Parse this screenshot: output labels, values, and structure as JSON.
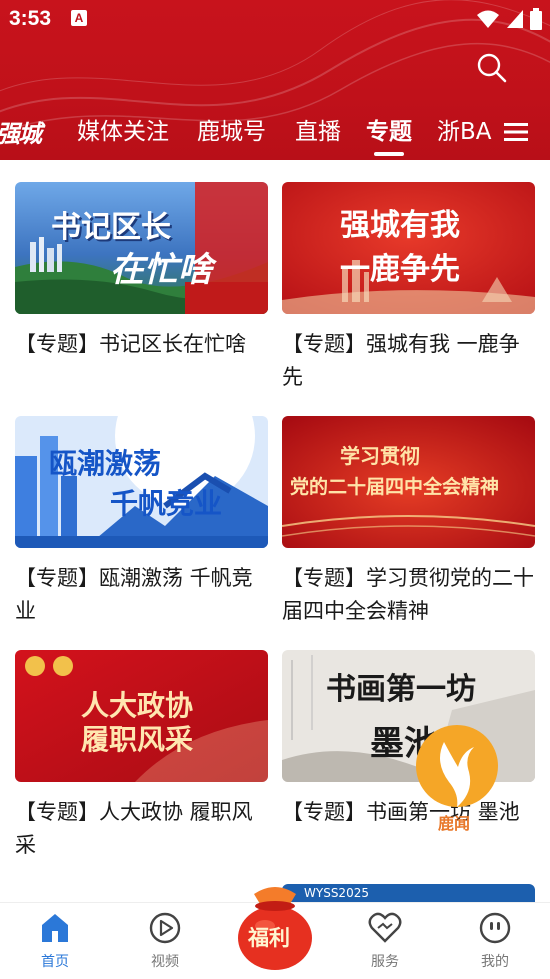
{
  "status_bar": {
    "time": "3:53",
    "notif_icon": "A"
  },
  "header": {
    "logo_text": "强城",
    "tabs": [
      {
        "label": "媒体关注"
      },
      {
        "label": "鹿城号"
      },
      {
        "label": "直播"
      },
      {
        "label": "专题",
        "active": true
      },
      {
        "label": "浙BA"
      }
    ],
    "icons": [
      "search-icon",
      "menu-icon"
    ]
  },
  "cards": [
    {
      "title": "【专题】书记区长在忙啥",
      "thumb_text": [
        "书记区长",
        "在忙啥"
      ]
    },
    {
      "title": "【专题】强城有我 一鹿争先",
      "thumb_text": [
        "强城有我",
        "一鹿争先"
      ]
    },
    {
      "title": "【专题】瓯潮激荡 千帆竞业",
      "thumb_text": [
        "瓯潮激荡",
        "千帆竞业"
      ]
    },
    {
      "title": "【专题】学习贯彻党的二十届四中全会精神",
      "thumb_text": [
        "学习贯彻",
        "党的二十届四中全会精神"
      ]
    },
    {
      "title": "【专题】人大政协 履职风采",
      "thumb_text": [
        "人大政协",
        "履职风采"
      ]
    },
    {
      "title": "【专题】书画第一坊 墨池",
      "thumb_text": [
        "书画第一坊",
        "墨池"
      ]
    }
  ],
  "partial_card_text": "WYSS2025",
  "float_badge_label": "鹿闻",
  "bottom_nav": {
    "items": [
      {
        "label": "首页",
        "icon": "home-icon",
        "active": true
      },
      {
        "label": "视频",
        "icon": "video-icon"
      },
      {
        "label": "福利",
        "icon": "gift-bag-icon"
      },
      {
        "label": "服务",
        "icon": "service-icon"
      },
      {
        "label": "我的",
        "icon": "profile-icon"
      }
    ]
  },
  "colors": {
    "brand_red": "#c0111a",
    "nav_active": "#2b78d8"
  }
}
